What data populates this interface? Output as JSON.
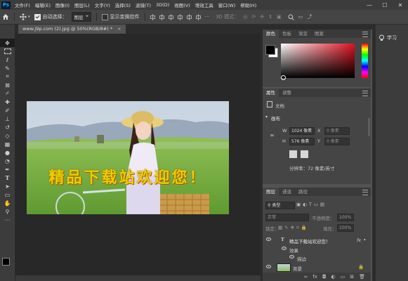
{
  "app": {
    "logo": "Ps"
  },
  "menu": [
    "文件(F)",
    "编辑(E)",
    "图像(I)",
    "图层(L)",
    "文字(Y)",
    "选择(S)",
    "滤镜(T)",
    "3D(D)",
    "视图(V)",
    "增效工具",
    "窗口(W)",
    "帮助(H)"
  ],
  "window_controls": {
    "minimize": "—",
    "maximize": "☐",
    "close": "✕"
  },
  "options_bar": {
    "auto_select_label": "自动选择：",
    "auto_select_checked": true,
    "auto_select_target": "图层",
    "show_transform_label": "显示变换控件",
    "show_transform_checked": false,
    "mode_3d_label": "3D 模式："
  },
  "document": {
    "tab_title": "www.j9p.com (2).jpg @ 50%(RGB/8#) *",
    "tab_close": "×",
    "watermark_text": "精品下载站欢迎您！"
  },
  "learn_panel": {
    "label": "学习"
  },
  "color_panel": {
    "tabs": [
      "颜色",
      "色板",
      "渐变",
      "图案"
    ],
    "foreground": "#000000",
    "background": "#ffffff",
    "hue_color": "#e01020"
  },
  "properties_panel": {
    "tabs": [
      "属性",
      "调整"
    ],
    "section_document": "文档",
    "section_canvas": "画布",
    "width_label": "W",
    "width_value": "1024 像素",
    "height_label": "H",
    "height_value": "576 像素",
    "x_label": "X",
    "x_value": "0 像素",
    "y_label": "Y",
    "y_value": "0 像素",
    "resolution": "分辨率：72 像素/英寸"
  },
  "layers_panel": {
    "tabs": [
      "图层",
      "通道",
      "路径"
    ],
    "filter_kind": "类型",
    "blend_mode": "正常",
    "opacity_label": "不透明度：",
    "opacity_value": "100%",
    "lock_label": "锁定：",
    "fill_label": "填充：",
    "fill_value": "100%",
    "layers": [
      {
        "name": "精品下载站欢迎您！",
        "type": "text",
        "fx": "fx"
      },
      {
        "name": "效果",
        "type": "effect"
      },
      {
        "name": "描边",
        "type": "effect-item"
      },
      {
        "name": "背景",
        "type": "background"
      }
    ]
  },
  "icons": {
    "home": "home-icon",
    "move": "move-icon",
    "learn": "lightbulb-icon"
  },
  "toolbar_tools": [
    "move-tool",
    "marquee-tool",
    "lasso-tool",
    "quick-select-tool",
    "crop-tool",
    "frame-tool",
    "eyedropper-tool",
    "healing-tool",
    "brush-tool",
    "stamp-tool",
    "history-brush-tool",
    "eraser-tool",
    "gradient-tool",
    "blur-tool",
    "dodge-tool",
    "pen-tool",
    "type-tool",
    "path-select-tool",
    "rectangle-tool",
    "hand-tool",
    "zoom-tool",
    "more-tools"
  ]
}
